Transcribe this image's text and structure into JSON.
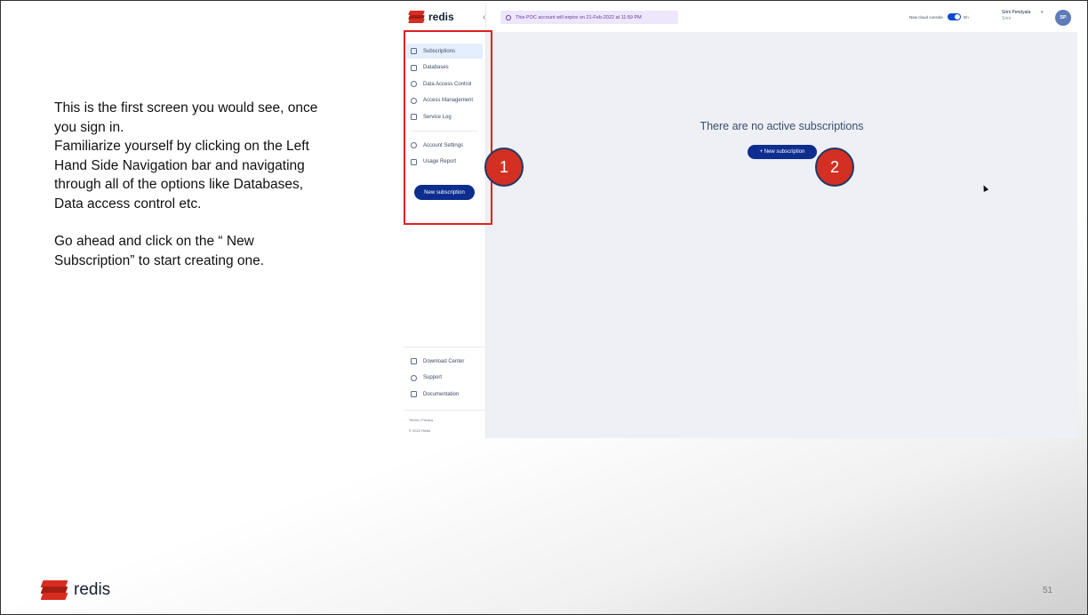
{
  "slide": {
    "paragraph1": [
      "This is the first screen you would see, once",
      "you sign in.",
      "Familiarize yourself by clicking on the Left",
      "Hand Side Navigation bar and navigating",
      "through all of the options like Databases,",
      "Data access control etc."
    ],
    "paragraph2": [
      "Go ahead and click on the “ New",
      "Subscription” to start creating one."
    ],
    "brand": "redis",
    "page_number": "51",
    "callouts": [
      "1",
      "2"
    ]
  },
  "app": {
    "logo_text": "redis",
    "collapse_icon": "‹",
    "sidebar": {
      "items": [
        {
          "label": "Subscriptions",
          "icon": "layers-icon",
          "active": true
        },
        {
          "label": "Databases",
          "icon": "database-icon",
          "active": false
        },
        {
          "label": "Data Access Control",
          "icon": "key-icon",
          "active": false
        },
        {
          "label": "Access Management",
          "icon": "user-icon",
          "active": false
        },
        {
          "label": "Service Log",
          "icon": "log-icon",
          "active": false
        }
      ],
      "secondary_items": [
        {
          "label": "Account Settings",
          "icon": "settings-icon"
        },
        {
          "label": "Usage Report",
          "icon": "report-icon"
        }
      ],
      "new_subscription_label": "New subscription",
      "bottom_items": [
        {
          "label": "Download Center",
          "icon": "download-icon"
        },
        {
          "label": "Support",
          "icon": "support-icon"
        },
        {
          "label": "Documentation",
          "icon": "document-icon"
        }
      ],
      "footer_links": "Terms | Privacy",
      "copyright": "© 2022 Redis"
    },
    "topbar": {
      "banner": "This POC account will expire on 21-Feb-2022 at 11:59 PM",
      "console_label": "New cloud console",
      "console_state": "On",
      "user_name": "Srini Pendyala",
      "user_sub": "Srini",
      "avatar_initials": "SP"
    },
    "main": {
      "empty_title": "There are no active subscriptions",
      "new_subscription_button": "+ New subscription"
    }
  },
  "colors": {
    "primary_button": "#0d2d8f",
    "highlight_border": "#e02020",
    "callout_fill": "#d32f22",
    "brand_red": "#d82c20"
  }
}
